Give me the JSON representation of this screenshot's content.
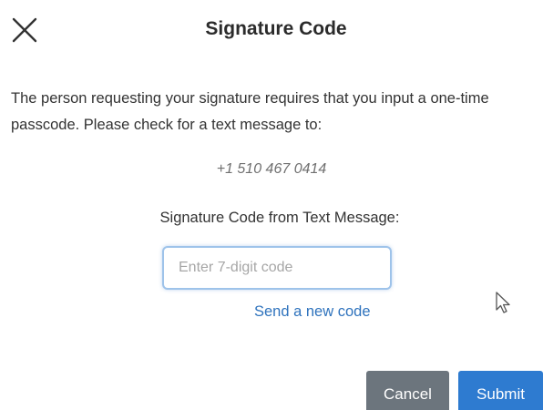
{
  "dialog": {
    "title": "Signature Code",
    "close_icon": "close-x-icon"
  },
  "message": {
    "text": "The person requesting your signature requires that you input a one-time passcode. Please check for a text message to:",
    "phone": "+1 510 467 0414"
  },
  "code_field": {
    "label": "Signature Code from Text Message:",
    "value": "",
    "placeholder": "Enter 7-digit code"
  },
  "resend_link": "Send a new code",
  "buttons": {
    "cancel_label": "Cancel",
    "submit_label": "Submit"
  },
  "colors": {
    "link": "#2f73bd",
    "cancel_bg": "#6c757d",
    "submit_bg": "#2e7bd0",
    "input_border": "#9ec3ea"
  },
  "pointer_icon": "mouse-pointer-icon"
}
